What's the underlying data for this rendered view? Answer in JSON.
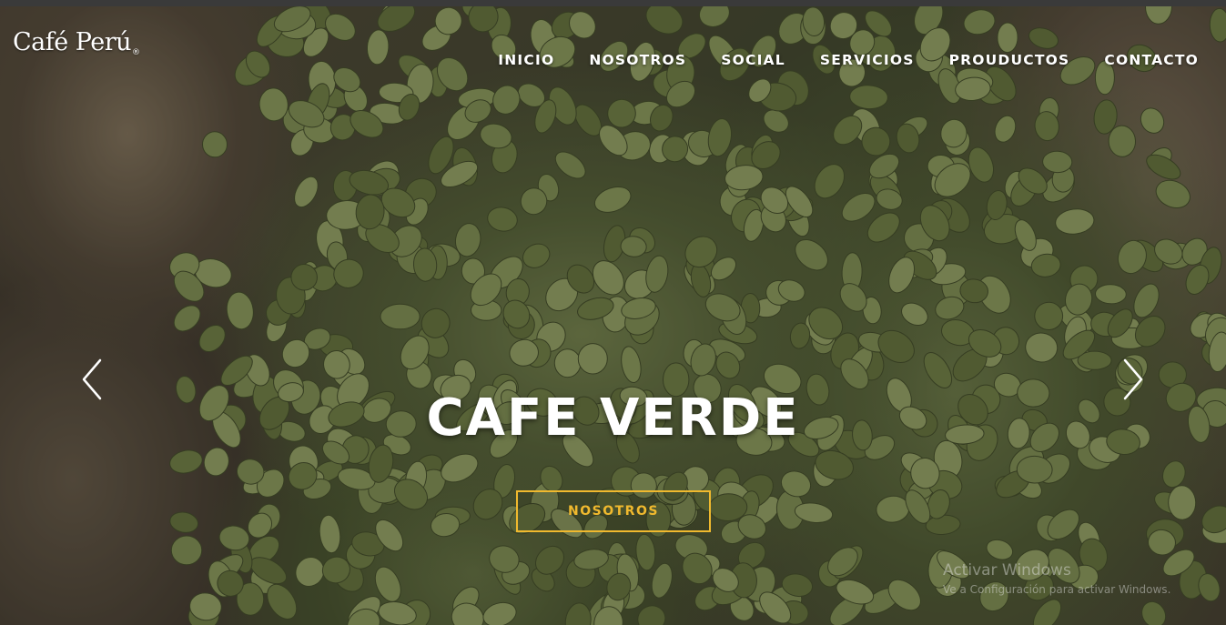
{
  "brand": {
    "logo_text": "Café Perú",
    "registered_mark": "®"
  },
  "nav": {
    "items": [
      {
        "label": "INICIO"
      },
      {
        "label": "NOSOTROS"
      },
      {
        "label": "SOCIAL"
      },
      {
        "label": "SERVICIOS"
      },
      {
        "label": "PROUDUCTOS"
      },
      {
        "label": "CONTACTO"
      }
    ]
  },
  "hero": {
    "title": "CAFE VERDE",
    "cta_label": "NOSOTROS",
    "prev_icon": "chevron-left-icon",
    "next_icon": "chevron-right-icon"
  },
  "watermark": {
    "title": "Activar Windows",
    "subtitle": "Ve a Configuración para activar Windows."
  },
  "colors": {
    "accent": "#f0b92e",
    "text": "#ffffff",
    "bean": "#7f8d55",
    "burlap": "#8c7c63"
  }
}
